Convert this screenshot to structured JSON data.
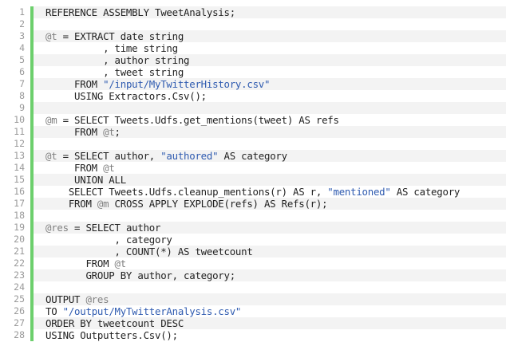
{
  "colors": {
    "change_bar": "#6ccf6c",
    "line_number": "#9a9a9a",
    "variable": "#808080",
    "string": "#2f5bb0",
    "text": "#222222",
    "alt_row": "#f3f3f3"
  },
  "lines": [
    {
      "n": "1",
      "tokens": [
        {
          "t": "plain",
          "v": "REFERENCE ASSEMBLY TweetAnalysis;"
        }
      ]
    },
    {
      "n": "2",
      "tokens": []
    },
    {
      "n": "3",
      "tokens": [
        {
          "t": "var",
          "v": "@t"
        },
        {
          "t": "plain",
          "v": " = EXTRACT date string"
        }
      ]
    },
    {
      "n": "4",
      "tokens": [
        {
          "t": "plain",
          "v": "          , time string"
        }
      ]
    },
    {
      "n": "5",
      "tokens": [
        {
          "t": "plain",
          "v": "          , author string"
        }
      ]
    },
    {
      "n": "6",
      "tokens": [
        {
          "t": "plain",
          "v": "          , tweet string"
        }
      ]
    },
    {
      "n": "7",
      "tokens": [
        {
          "t": "plain",
          "v": "     FROM "
        },
        {
          "t": "str",
          "v": "\"/input/MyTwitterHistory.csv\""
        }
      ]
    },
    {
      "n": "8",
      "tokens": [
        {
          "t": "plain",
          "v": "     USING Extractors.Csv();"
        }
      ]
    },
    {
      "n": "9",
      "tokens": []
    },
    {
      "n": "10",
      "tokens": [
        {
          "t": "var",
          "v": "@m"
        },
        {
          "t": "plain",
          "v": " = SELECT Tweets.Udfs.get_mentions(tweet) AS refs"
        }
      ]
    },
    {
      "n": "11",
      "tokens": [
        {
          "t": "plain",
          "v": "     FROM "
        },
        {
          "t": "var",
          "v": "@t"
        },
        {
          "t": "plain",
          "v": ";"
        }
      ]
    },
    {
      "n": "12",
      "tokens": []
    },
    {
      "n": "13",
      "tokens": [
        {
          "t": "var",
          "v": "@t"
        },
        {
          "t": "plain",
          "v": " = SELECT author, "
        },
        {
          "t": "str",
          "v": "\"authored\""
        },
        {
          "t": "plain",
          "v": " AS category"
        }
      ]
    },
    {
      "n": "14",
      "tokens": [
        {
          "t": "plain",
          "v": "     FROM "
        },
        {
          "t": "var",
          "v": "@t"
        }
      ]
    },
    {
      "n": "15",
      "tokens": [
        {
          "t": "plain",
          "v": "     UNION ALL"
        }
      ]
    },
    {
      "n": "16",
      "tokens": [
        {
          "t": "plain",
          "v": "    SELECT Tweets.Udfs.cleanup_mentions(r) AS r, "
        },
        {
          "t": "str",
          "v": "\"mentioned\""
        },
        {
          "t": "plain",
          "v": " AS category"
        }
      ]
    },
    {
      "n": "17",
      "tokens": [
        {
          "t": "plain",
          "v": "    FROM "
        },
        {
          "t": "var",
          "v": "@m"
        },
        {
          "t": "plain",
          "v": " CROSS APPLY EXPLODE(refs) AS Refs(r);"
        }
      ]
    },
    {
      "n": "18",
      "tokens": []
    },
    {
      "n": "19",
      "tokens": [
        {
          "t": "var",
          "v": "@res"
        },
        {
          "t": "plain",
          "v": " = SELECT author"
        }
      ]
    },
    {
      "n": "20",
      "tokens": [
        {
          "t": "plain",
          "v": "            , category"
        }
      ]
    },
    {
      "n": "21",
      "tokens": [
        {
          "t": "plain",
          "v": "            , COUNT(*) AS tweetcount"
        }
      ]
    },
    {
      "n": "22",
      "tokens": [
        {
          "t": "plain",
          "v": "       FROM "
        },
        {
          "t": "var",
          "v": "@t"
        }
      ]
    },
    {
      "n": "23",
      "tokens": [
        {
          "t": "plain",
          "v": "       GROUP BY author, category;"
        }
      ]
    },
    {
      "n": "24",
      "tokens": []
    },
    {
      "n": "25",
      "tokens": [
        {
          "t": "plain",
          "v": "OUTPUT "
        },
        {
          "t": "var",
          "v": "@res"
        }
      ]
    },
    {
      "n": "26",
      "tokens": [
        {
          "t": "plain",
          "v": "TO "
        },
        {
          "t": "str",
          "v": "\"/output/MyTwitterAnalysis.csv\""
        }
      ]
    },
    {
      "n": "27",
      "tokens": [
        {
          "t": "plain",
          "v": "ORDER BY tweetcount DESC"
        }
      ]
    },
    {
      "n": "28",
      "tokens": [
        {
          "t": "plain",
          "v": "USING Outputters.Csv();"
        }
      ]
    }
  ]
}
